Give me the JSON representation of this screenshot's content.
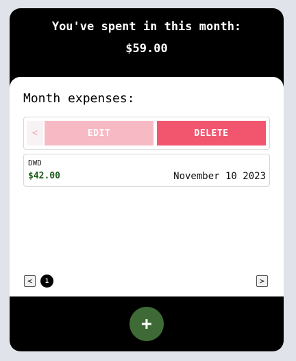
{
  "header": {
    "title": "You've spent in this month:",
    "total": "$59.00"
  },
  "expenses_section": {
    "title": "Month expenses:"
  },
  "swipe_actions": {
    "back_icon": "chevron-left-icon",
    "back_glyph": "<",
    "edit_label": "EDIT",
    "delete_label": "DELETE"
  },
  "expenses": [
    {
      "name": "DWD",
      "amount": "$42.00",
      "date": "November 10 2023"
    }
  ],
  "pagination": {
    "prev_glyph": "<",
    "next_glyph": ">",
    "current_page": "1"
  },
  "fab": {
    "glyph": "+",
    "icon": "plus-icon"
  },
  "colors": {
    "page_bg": "#e1e3ea",
    "edit": "#f7b9c3",
    "delete": "#f2566f",
    "amount": "#1d5c1d",
    "fab": "#3e6b35"
  }
}
